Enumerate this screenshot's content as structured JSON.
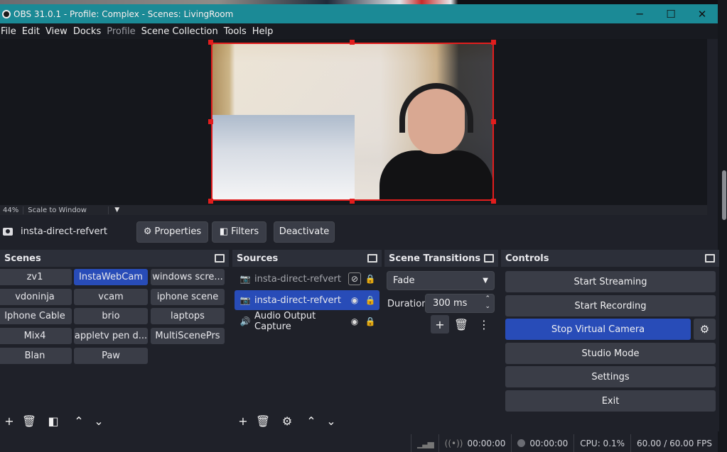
{
  "window": {
    "title": "OBS 31.0.1 - Profile: Complex - Scenes: LivingRoom",
    "minimize": "─",
    "maximize": "☐",
    "close": "✕"
  },
  "menu": [
    "File",
    "Edit",
    "View",
    "Docks",
    "Profile",
    "Scene Collection",
    "Tools",
    "Help"
  ],
  "preview": {
    "zoom": "44%",
    "scale_mode": "Scale to Window"
  },
  "source_toolbar": {
    "source_name": "insta-direct-refvert",
    "properties": "Properties",
    "filters": "Filters",
    "deactivate": "Deactivate"
  },
  "scenes": {
    "title": "Scenes",
    "items": [
      "zv1",
      "InstaWebCam",
      "windows scre...",
      "vdoninja",
      "vcam",
      "iphone scene",
      "Iphone Cable",
      "brio",
      "laptops",
      "Mix4",
      "appletv pen d...",
      "MultiScenePrs",
      "Blan",
      "Paw"
    ],
    "active": "InstaWebCam"
  },
  "sources": {
    "title": "Sources",
    "items": [
      {
        "name": "insta-direct-refvert",
        "visible": false,
        "locked": true,
        "icon": "camera-icon"
      },
      {
        "name": "insta-direct-refvert",
        "visible": true,
        "locked": true,
        "icon": "camera-icon"
      },
      {
        "name": "Audio Output Capture",
        "visible": true,
        "locked": true,
        "icon": "speaker-icon"
      }
    ]
  },
  "transitions": {
    "title": "Scene Transitions",
    "selected": "Fade",
    "duration_label": "Duration",
    "duration": "300 ms"
  },
  "controls": {
    "title": "Controls",
    "start_streaming": "Start Streaming",
    "start_recording": "Start Recording",
    "stop_virtual_camera": "Stop Virtual Camera",
    "studio_mode": "Studio Mode",
    "settings": "Settings",
    "exit": "Exit"
  },
  "status": {
    "stream_time": "00:00:00",
    "record_time": "00:00:00",
    "cpu": "CPU: 0.1%",
    "fps": "60.00 / 60.00 FPS"
  },
  "colors": {
    "accent": "#284cb8",
    "titlebar": "#1b8a96",
    "selection": "#e21d1d"
  }
}
